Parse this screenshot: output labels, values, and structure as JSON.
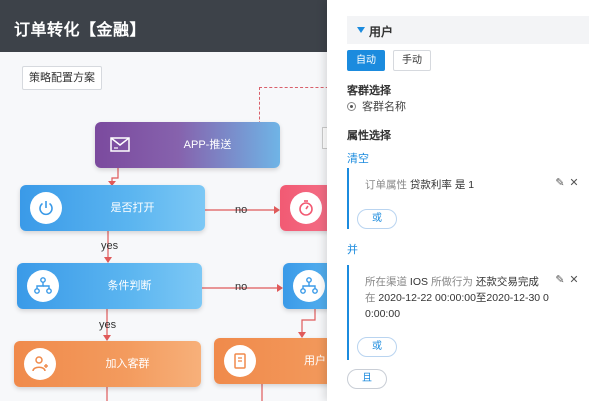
{
  "header": {
    "title": "订单转化【金融】"
  },
  "canvas": {
    "strategy_button": "策略配置方案",
    "nodes": {
      "app_push": "APP-推送",
      "is_open": "是否打开",
      "condition": "条件判断",
      "join_group": "加入客群",
      "use": "用户"
    },
    "edge_labels": {
      "no1": "no",
      "yes1": "yes",
      "no2": "no",
      "yes2": "yes"
    },
    "icons": [
      "message-icon",
      "power-icon",
      "timer-icon",
      "hierarchy-icon",
      "add-user-icon",
      "document-icon"
    ]
  },
  "panel": {
    "section_title": "用户",
    "mode_auto": "自动",
    "mode_manual": "手动",
    "group_select_title": "客群选择",
    "group_option": "客群名称",
    "attr_select_title": "属性选择",
    "clear_link": "清空",
    "card1": {
      "field": "订单属性",
      "value": "贷款利率 是 1"
    },
    "or_button_1": "或",
    "and_link": "并",
    "card2": {
      "line1_label": "所在渠道",
      "line1_channel": "IOS",
      "line1_action_label": "所做行为",
      "line1_action": "还款交易完成",
      "line2_prefix": "在",
      "line2_range": "2020-12-22 00:00:00至2020-12-30 0",
      "line3": "0:00:00"
    },
    "or_button_2": "或",
    "and_button": "且"
  },
  "colors": {
    "accent": "#1b8bde",
    "header_bg": "#3d4249",
    "node_blue": "#3a9ae8",
    "node_orange": "#f08a4b",
    "node_purple": "#7b4a9e",
    "node_red": "#f25a73",
    "edge": "#e05a5a"
  }
}
